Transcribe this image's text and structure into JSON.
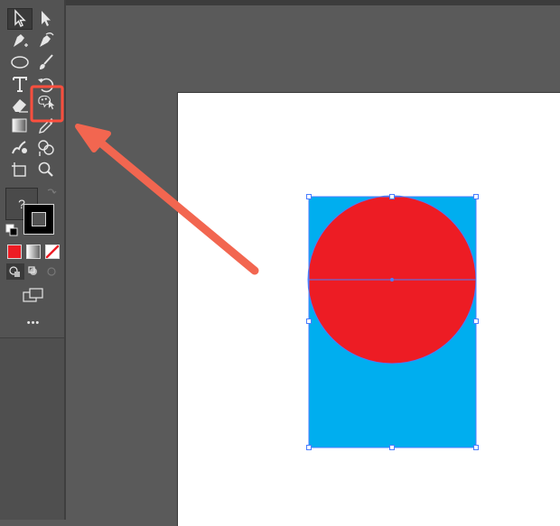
{
  "app": {
    "fill_help_label": "?",
    "more_tools_label": "•••"
  },
  "toolbar": {
    "tools": [
      {
        "name": "selection-tool",
        "icon": "arrow-icon"
      },
      {
        "name": "direct-selection-tool",
        "icon": "direct-arrow-icon"
      },
      {
        "name": "pen-tool",
        "icon": "pen-icon"
      },
      {
        "name": "curvature-tool",
        "icon": "curvature-pen-icon"
      },
      {
        "name": "ellipse-tool",
        "icon": "ellipse-icon"
      },
      {
        "name": "paintbrush-tool",
        "icon": "brush-icon"
      },
      {
        "name": "type-tool",
        "icon": "type-icon"
      },
      {
        "name": "rotate-tool",
        "icon": "rotate-icon"
      },
      {
        "name": "eraser-tool",
        "icon": "eraser-icon"
      },
      {
        "name": "puppet-warp-tool",
        "icon": "puppet-warp-icon"
      },
      {
        "name": "gradient-tool",
        "icon": "gradient-icon"
      },
      {
        "name": "eyedropper-tool",
        "icon": "eyedropper-icon"
      },
      {
        "name": "blend-tool",
        "icon": "blend-icon"
      },
      {
        "name": "shape-builder-tool",
        "icon": "shape-builder-icon"
      },
      {
        "name": "artboard-tool",
        "icon": "artboard-icon"
      },
      {
        "name": "zoom-tool",
        "icon": "zoom-icon"
      }
    ],
    "highlighted_tool": "puppet-warp-tool"
  },
  "colors": {
    "toolbar_bg": "#535353",
    "canvas_bg": "#5a5a5a",
    "artboard": "#ffffff",
    "rectangle_fill": "#00aeef",
    "circle_fill": "#ed1c24",
    "selection": "#4a7dff",
    "highlight": "#ff4f3e",
    "arrow": "#f26650"
  }
}
